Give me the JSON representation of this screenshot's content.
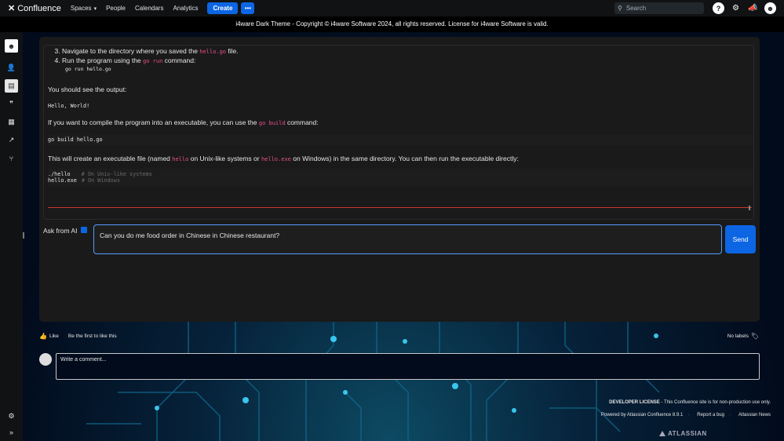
{
  "topnav": {
    "logo": "Confluence",
    "links": [
      "Spaces",
      "People",
      "Calendars",
      "Analytics"
    ],
    "create": "Create",
    "more": "•••",
    "search_placeholder": "Search"
  },
  "banner": "i4ware Dark Theme - Copyright © i4ware Software 2024, all rights reserved. License for i4ware Software is valid.",
  "content": {
    "step3_pre": "Navigate to the directory where you saved the ",
    "step3_code": "hello.go",
    "step3_post": " file.",
    "step4_pre": "Run the program using the ",
    "step4_code": "go run",
    "step4_post": " command:",
    "step4_cmd": "go run hello.go",
    "see_output": "You should see the output:",
    "output": "Hello, World!",
    "compile_pre": "If you want to compile the program into an executable, you can use the ",
    "compile_code": "go build",
    "compile_post": " command:",
    "build_cmd": "go build hello.go",
    "exec_pre": "This will create an executable file (named ",
    "exec_code1": "hello",
    "exec_mid1": " on Unix-like systems or ",
    "exec_code2": "hello.exe",
    "exec_post": " on Windows) in the same directory. You can then run the executable directly:",
    "run1": "./hello",
    "run1_comment": "# On Unix-like systems",
    "run2": "hello.exe",
    "run2_comment": "# On Windows"
  },
  "ask": {
    "label": "Ask from AI",
    "input_value": "Can you do me food order in Chinese in Chinese restaurant?",
    "send": "Send"
  },
  "like": {
    "like_label": "Like",
    "first": "Be the first to like this",
    "no_labels": "No labels"
  },
  "comment": {
    "placeholder": "Write a comment..."
  },
  "footer": {
    "license_bold": "DEVELOPER LICENSE",
    "license_rest": " - This Confluence site is for non-production use only.",
    "powered": "Powered by Atlassian Confluence 8.9.1",
    "report": "Report a bug",
    "news": "Atlassian News",
    "atlassian": "ATLASSIAN"
  },
  "colors": {
    "accent": "#0c66e4",
    "code": "#e8508c",
    "panel": "#1a1a1a"
  }
}
